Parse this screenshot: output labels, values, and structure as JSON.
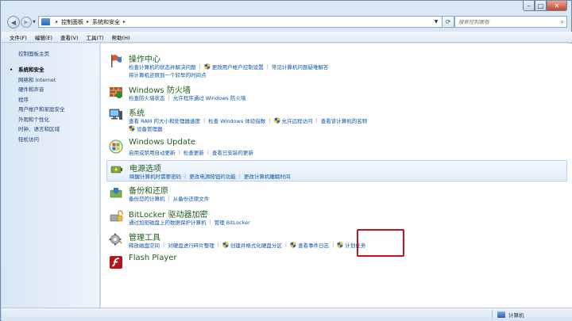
{
  "window": {
    "btn_min": "–",
    "btn_max": "□",
    "btn_close": "✕"
  },
  "address": {
    "crumbs": [
      "控制面板",
      "系统和安全"
    ],
    "search_placeholder": "搜索控制面板"
  },
  "menu": [
    "文件(F)",
    "编辑(E)",
    "查看(V)",
    "工具(T)",
    "帮助(H)"
  ],
  "sidebar": {
    "home": "控制面板主页",
    "items": [
      "系统和安全",
      "网络和 Internet",
      "硬件和声音",
      "程序",
      "用户帐户和家庭安全",
      "外观和个性化",
      "时钟、语言和区域",
      "轻松访问"
    ]
  },
  "categories": [
    {
      "title": "操作中心",
      "lines": [
        [
          {
            "text": "检查计算机的状态并解决问题"
          },
          {
            "text": "更改用户帐户控制设置",
            "shield": true
          },
          {
            "text": "常见计算机问题疑难解答"
          }
        ],
        [
          {
            "text": "将计算机还原到一个较早的时间点"
          }
        ]
      ]
    },
    {
      "title": "Windows 防火墙",
      "lines": [
        [
          {
            "text": "检查防火墙状态"
          },
          {
            "text": "允许程序通过 Windows 防火墙"
          }
        ]
      ]
    },
    {
      "title": "系统",
      "lines": [
        [
          {
            "text": "查看 RAM 的大小和处理器速度"
          },
          {
            "text": "检查 Windows 体验指数"
          },
          {
            "text": "允许远程访问",
            "shield": true
          },
          {
            "text": "查看该计算机的名称"
          }
        ],
        [
          {
            "text": "设备管理器",
            "shield": true
          }
        ]
      ]
    },
    {
      "title": "Windows Update",
      "lines": [
        [
          {
            "text": "启用或禁用自动更新"
          },
          {
            "text": "检查更新"
          },
          {
            "text": "查看已安装的更新"
          }
        ]
      ]
    },
    {
      "title": "电源选项",
      "lines": [
        [
          {
            "text": "唤醒计算机时需要密码"
          },
          {
            "text": "更改电源按钮的功能"
          },
          {
            "text": "更改计算机睡眠时间"
          }
        ]
      ]
    },
    {
      "title": "备份和还原",
      "lines": [
        [
          {
            "text": "备份您的计算机"
          },
          {
            "text": "从备份还原文件"
          }
        ]
      ]
    },
    {
      "title": "BitLocker 驱动器加密",
      "lines": [
        [
          {
            "text": "通过加密磁盘上的数据保护计算机"
          },
          {
            "text": "管理 BitLocker"
          }
        ]
      ]
    },
    {
      "title": "管理工具",
      "lines": [
        [
          {
            "text": "释放磁盘空间"
          },
          {
            "text": "对硬盘进行碎片整理"
          },
          {
            "text": "创建并格式化硬盘分区",
            "shield": true
          },
          {
            "text": "查看事件日志",
            "shield": true
          },
          {
            "text": "计划任务",
            "shield": true
          }
        ]
      ]
    },
    {
      "title": "Flash Player",
      "lines": []
    }
  ],
  "status": {
    "label": "计算机"
  },
  "colors": {
    "link": "#0b55a8",
    "title": "#1e5c1e",
    "highlight_box": "#c0161b"
  }
}
